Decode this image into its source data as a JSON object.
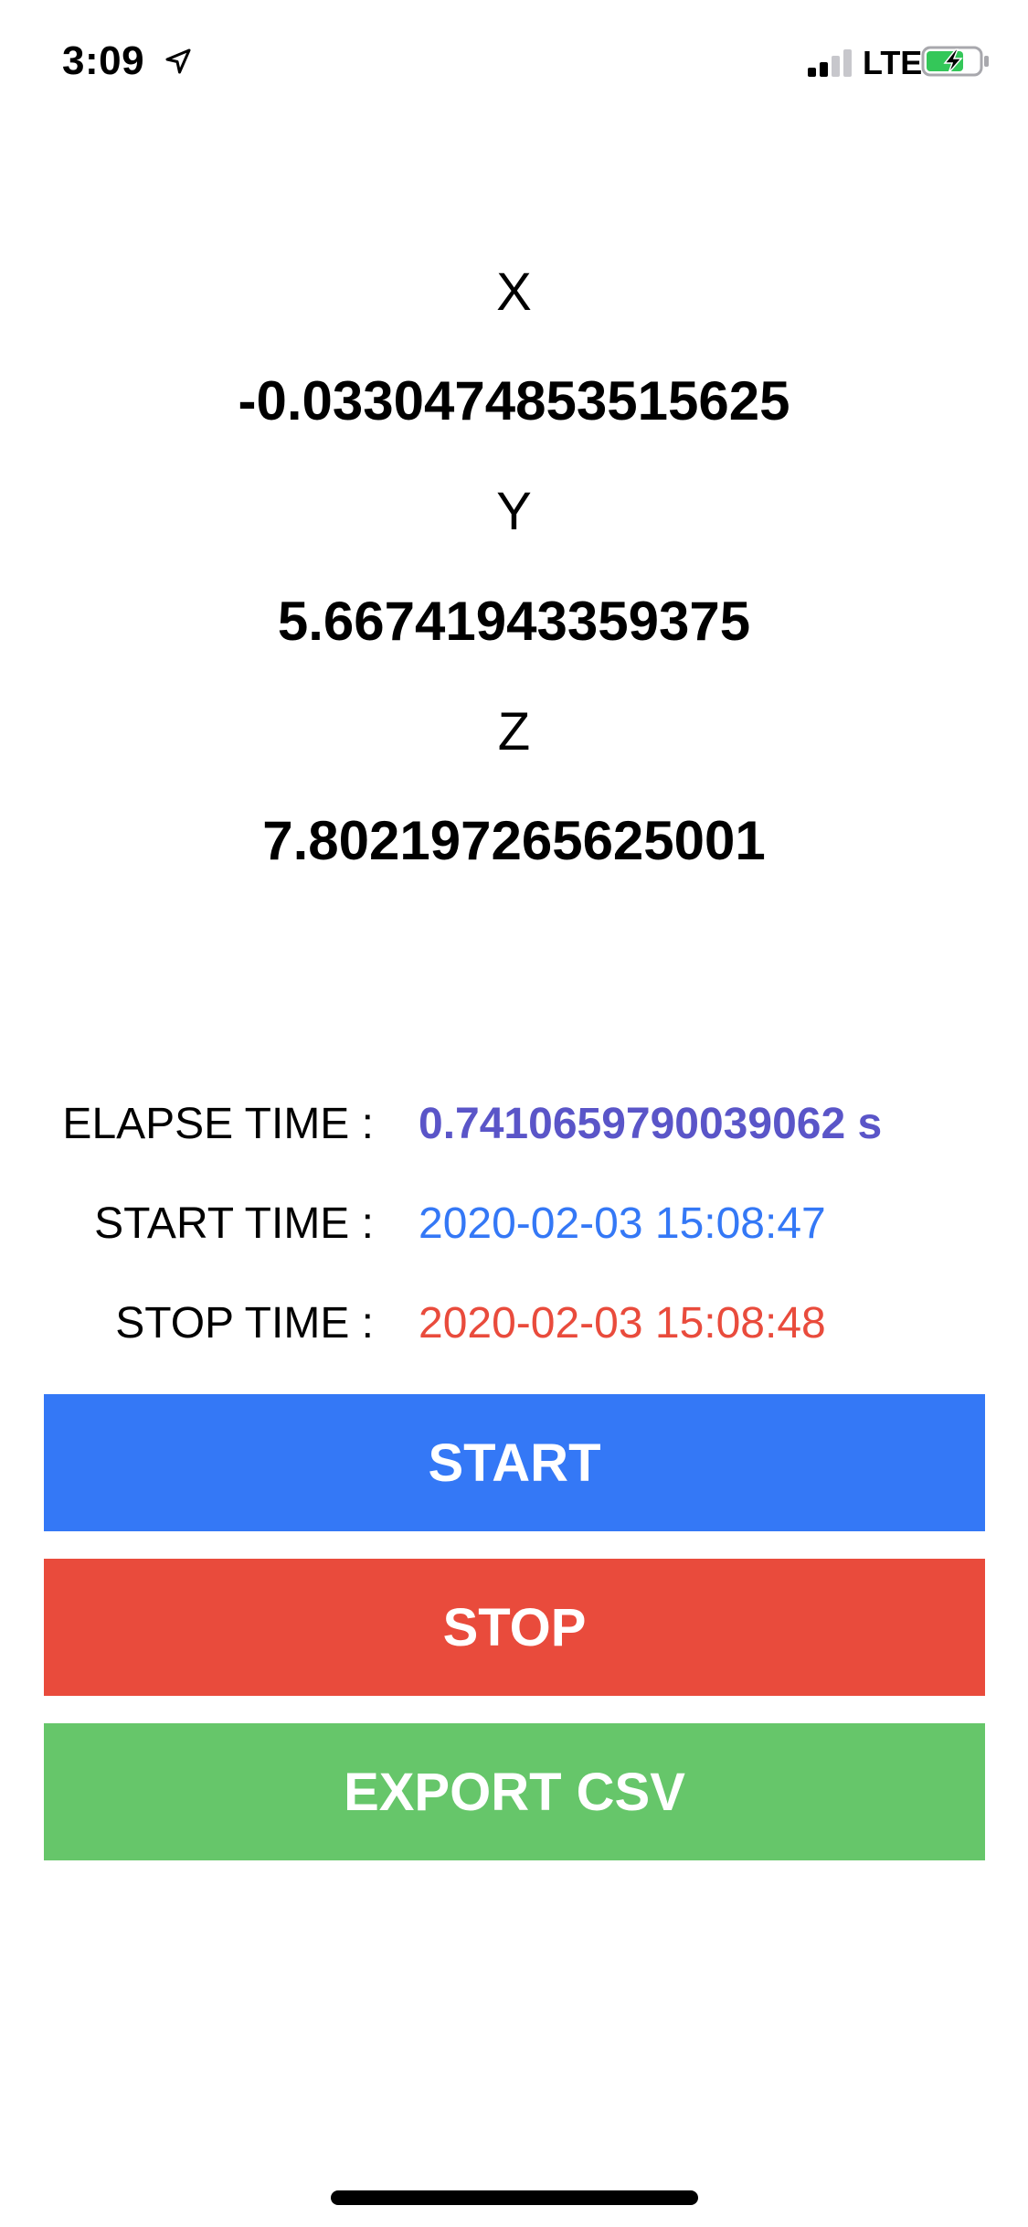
{
  "status_bar": {
    "time": "3:09",
    "network": "LTE",
    "icons": [
      "location-arrow-icon",
      "cellular-signal-icon",
      "battery-charging-icon"
    ],
    "battery_color": "#34c759"
  },
  "axes": [
    {
      "label": "X",
      "value": "-0.0330474853515625"
    },
    {
      "label": "Y",
      "value": "5.66741943359375"
    },
    {
      "label": "Z",
      "value": "7.802197265625001"
    }
  ],
  "timing": {
    "elapse": {
      "label": "ELAPSE TIME :",
      "value": "0.7410659790039062 s",
      "color": "#5a55c8"
    },
    "start": {
      "label": "START TIME :",
      "value": "2020-02-03 15:08:47",
      "color": "#3478f6"
    },
    "stop": {
      "label": "STOP TIME :",
      "value": "2020-02-03 15:08:48",
      "color": "#e94b3c"
    }
  },
  "buttons": {
    "start": {
      "label": "START",
      "color": "#3478f6"
    },
    "stop": {
      "label": "STOP",
      "color": "#e94b3c"
    },
    "export": {
      "label": "EXPORT CSV",
      "color": "#66c66a"
    }
  }
}
